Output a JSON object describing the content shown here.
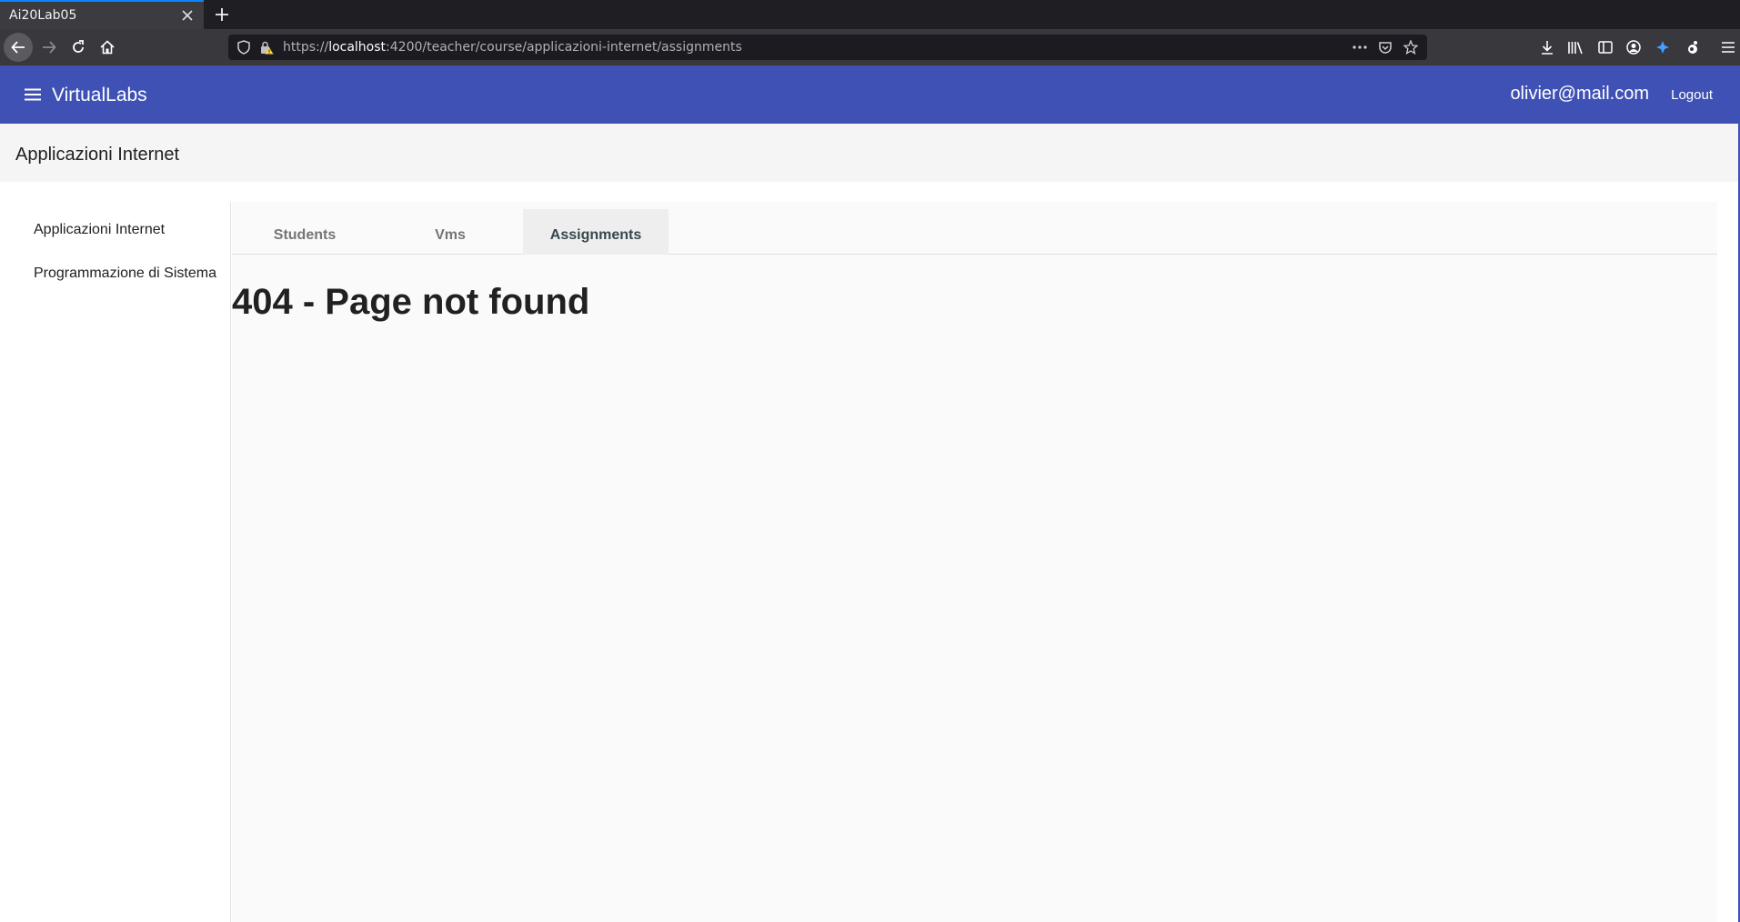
{
  "browser": {
    "tab_title": "Ai20Lab05",
    "url_scheme": "https://",
    "url_host": "localhost",
    "url_rest": ":4200/teacher/course/applicazioni-internet/assignments"
  },
  "toolbar": {
    "brand": "VirtualLabs",
    "user_email": "olivier@mail.com",
    "logout_label": "Logout"
  },
  "course": {
    "title": "Applicazioni Internet"
  },
  "sidenav": {
    "items": [
      {
        "label": "Applicazioni Internet"
      },
      {
        "label": "Programmazione di Sistema"
      }
    ]
  },
  "tabs": [
    {
      "label": "Students",
      "active": false
    },
    {
      "label": "Vms",
      "active": false
    },
    {
      "label": "Assignments",
      "active": true
    }
  ],
  "main": {
    "message": "404 - Page not found"
  },
  "colors": {
    "primary": "#3f51b5",
    "chrome_dark": "#38383d"
  }
}
